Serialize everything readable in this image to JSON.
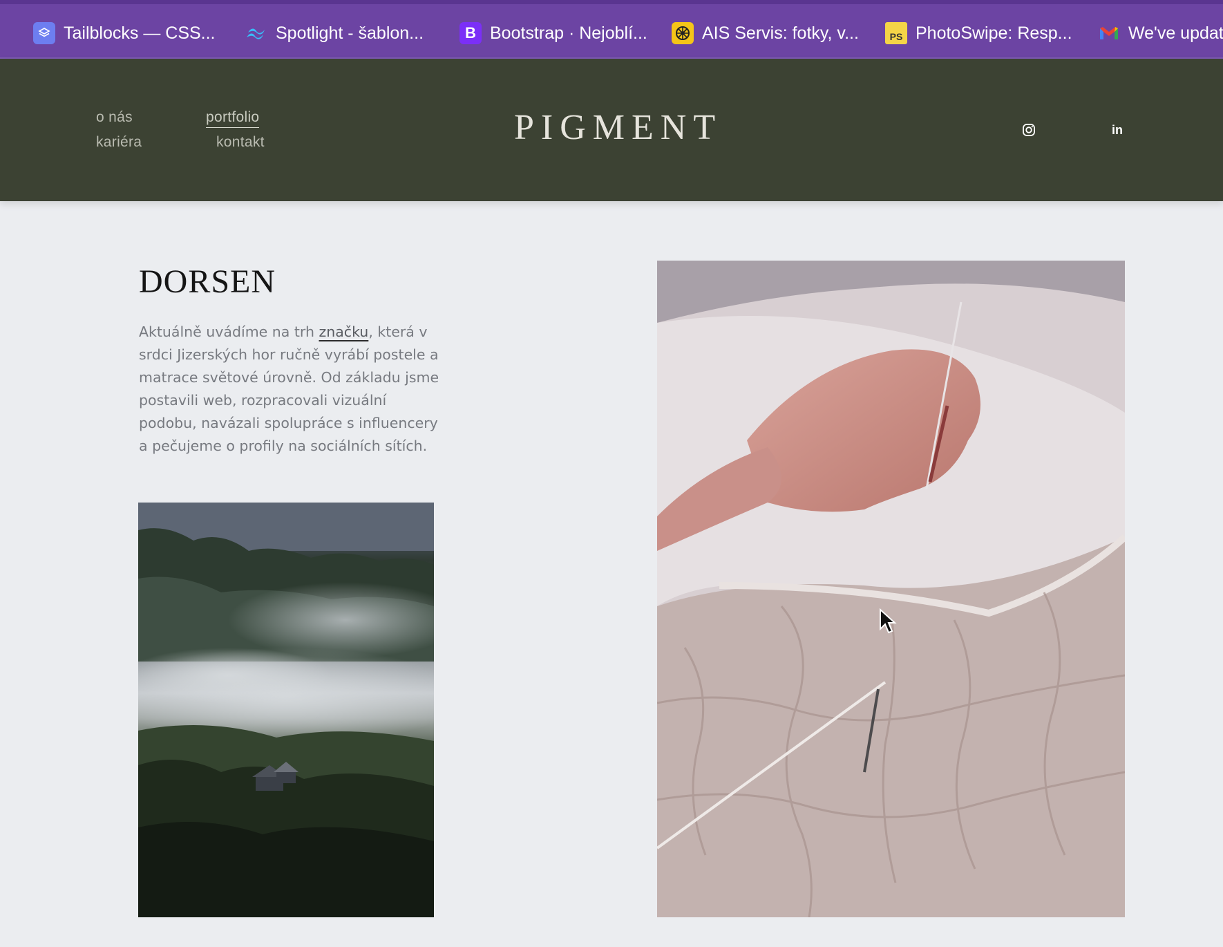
{
  "bookmarks": [
    {
      "label": "Tailblocks — CSS...",
      "icon": "layers-icon",
      "color": "#6d7ef0"
    },
    {
      "label": "Spotlight - šablon...",
      "icon": "tailwind-icon",
      "color": "#38bdf8"
    },
    {
      "label": "Bootstrap · Nejoblí...",
      "icon": "bootstrap-icon",
      "color": "#7b2ff7"
    },
    {
      "label": "AIS Servis: fotky, v...",
      "icon": "aperture-icon",
      "color": "#f5c518"
    },
    {
      "label": "PhotoSwipe: Resp...",
      "icon": "ps-icon",
      "color": "#f5d547"
    },
    {
      "label": "We've updat",
      "icon": "gmail-icon",
      "color": "#ea4335"
    }
  ],
  "header": {
    "nav": {
      "about": "o nás",
      "portfolio": "portfolio",
      "career": "kariéra",
      "contact": "kontakt"
    },
    "logo": "PIGMENT",
    "social": {
      "instagram": "instagram-icon",
      "linkedin": "in"
    }
  },
  "content": {
    "title": "DORSEN",
    "desc_before": "Aktuálně uvádíme na trh ",
    "desc_link": "značku",
    "desc_after": ", která v srdci Jizerských hor ručně vyrábí postele a matrace světové úrovně. Od základu jsme postavili web, rozpracovali vizuální podobu, navázali spolupráce s influencery a pečujeme o profily na sociálních sítích."
  },
  "colors": {
    "bookmarks_bar": "#6c44a3",
    "header_bg": "#3c4233",
    "page_bg": "#ebedf0"
  }
}
